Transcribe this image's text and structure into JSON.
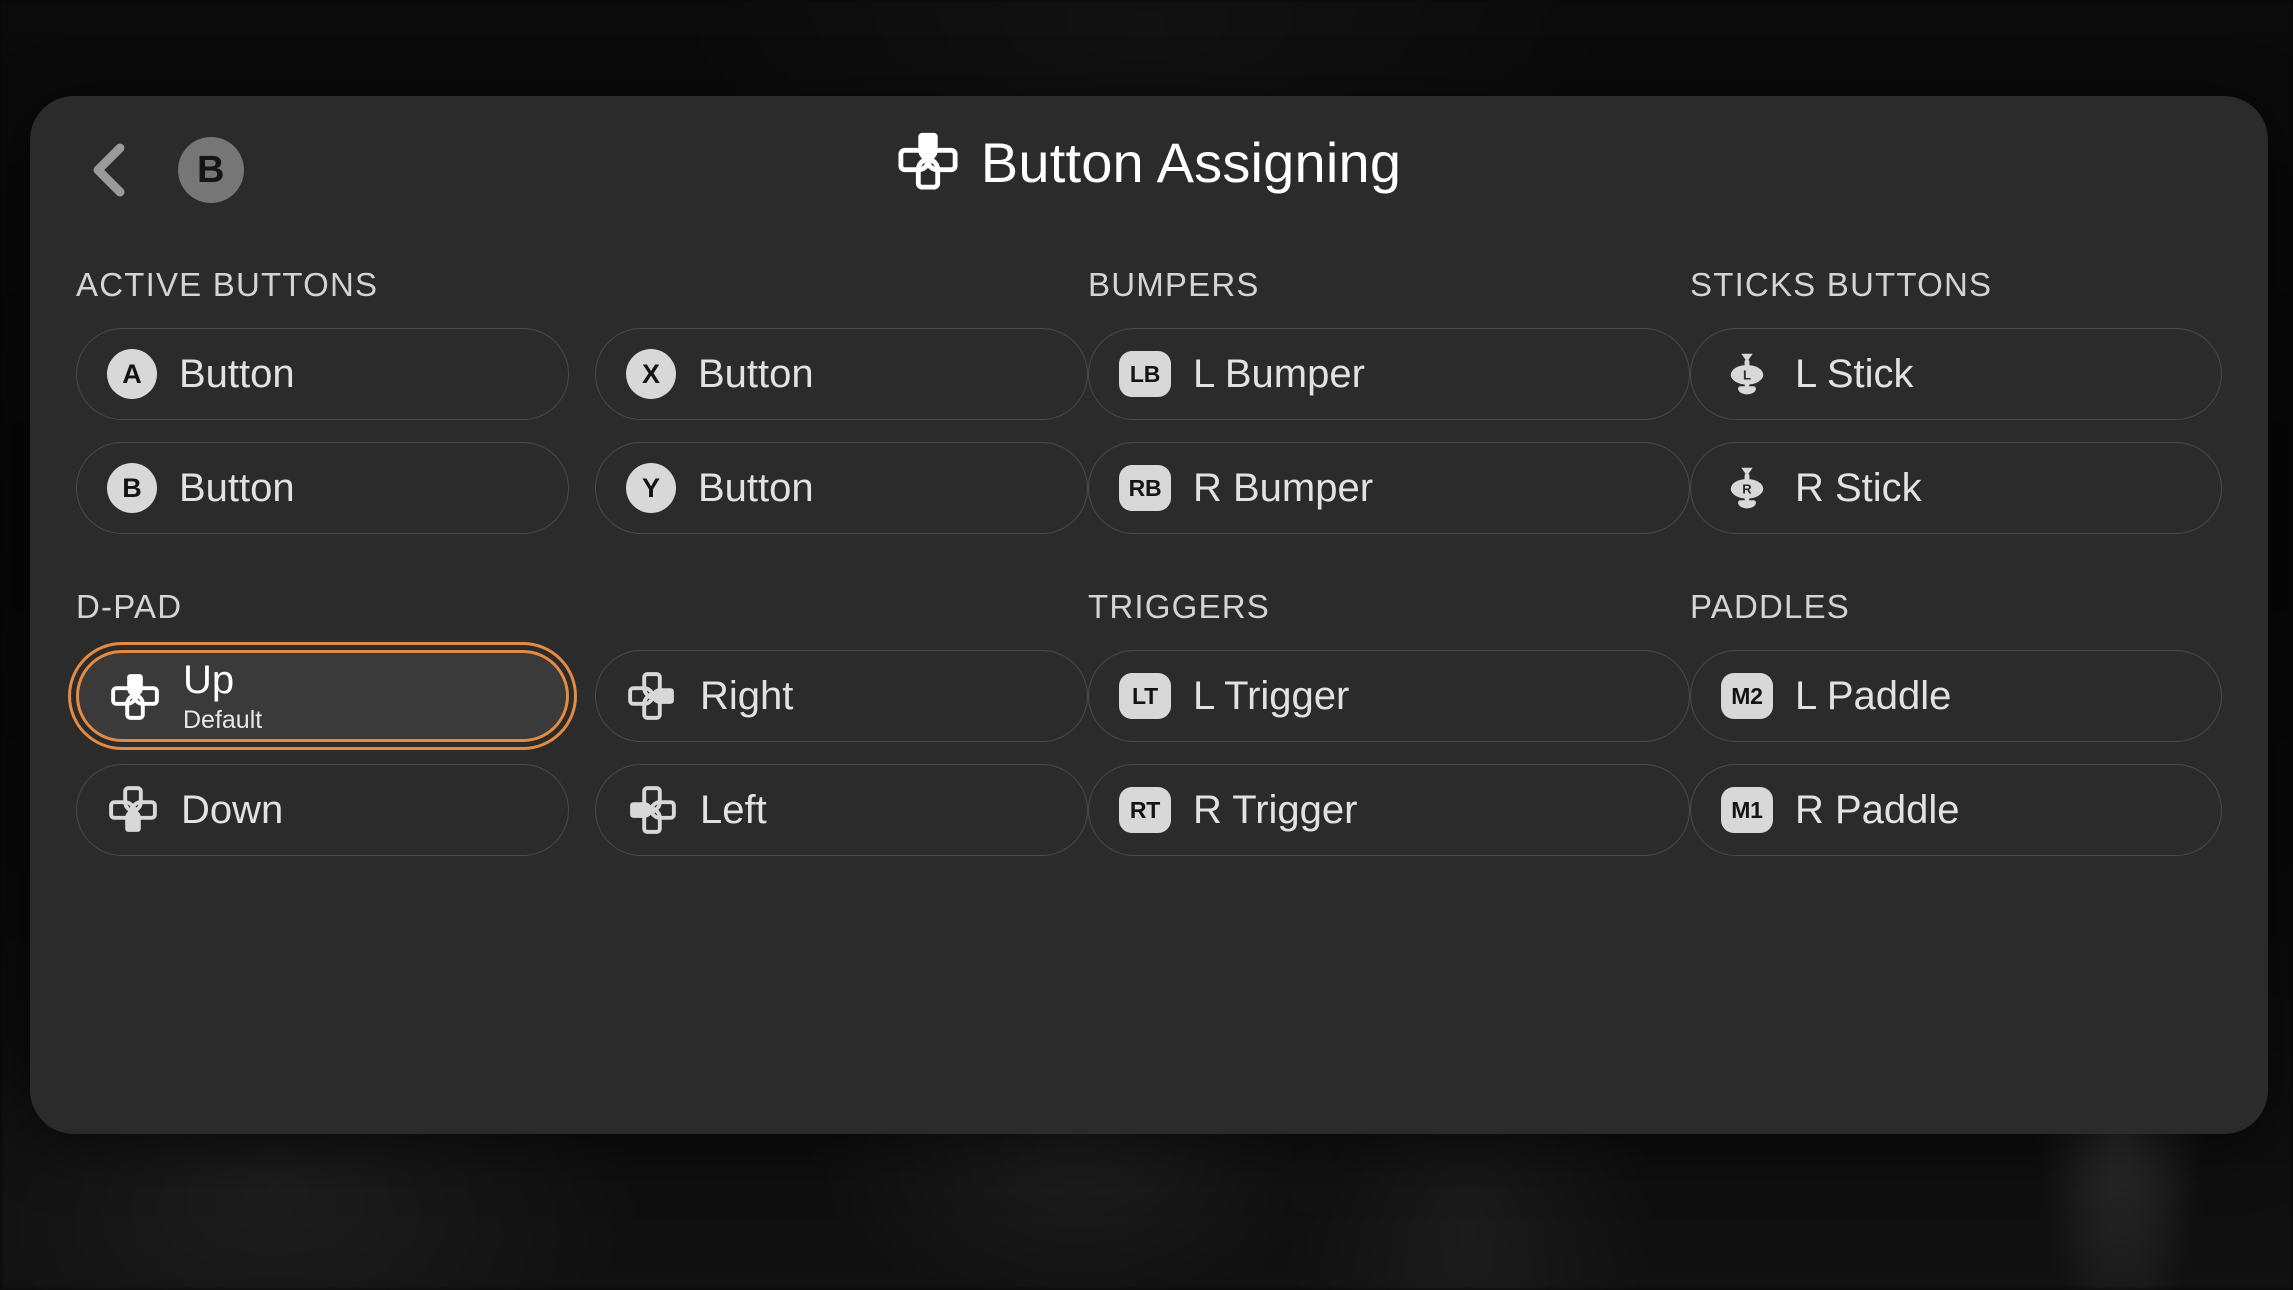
{
  "header": {
    "back_icon": "chevron-left-icon",
    "badge_label": "B",
    "title_icon": "dpad-icon",
    "title": "Button Assigning"
  },
  "colors": {
    "accent": "#e38b42",
    "panel_bg": "#2b2b2b",
    "page_bg": "#070707",
    "item_border": "#4a4a4a",
    "badge_bg": "#d8d8d8",
    "text_primary": "#e2e2e2",
    "section_label": "#d4d4d4"
  },
  "sections": [
    {
      "id": "active-buttons",
      "label": "ACTIVE BUTTONS",
      "columns": 2,
      "items": [
        {
          "badge_type": "circle",
          "badge": "A",
          "icon": "button-a-icon",
          "label": "Button",
          "selected": false
        },
        {
          "badge_type": "circle",
          "badge": "X",
          "icon": "button-x-icon",
          "label": "Button",
          "selected": false
        },
        {
          "badge_type": "circle",
          "badge": "B",
          "icon": "button-b-icon",
          "label": "Button",
          "selected": false
        },
        {
          "badge_type": "circle",
          "badge": "Y",
          "icon": "button-y-icon",
          "label": "Button",
          "selected": false
        }
      ]
    },
    {
      "id": "d-pad",
      "label": "D-PAD",
      "columns": 2,
      "items": [
        {
          "badge_type": "dpad",
          "dir": "up",
          "icon": "dpad-up-icon",
          "label": "Up",
          "sublabel": "Default",
          "selected": true
        },
        {
          "badge_type": "dpad",
          "dir": "right",
          "icon": "dpad-right-icon",
          "label": "Right",
          "selected": false
        },
        {
          "badge_type": "dpad",
          "dir": "down",
          "icon": "dpad-down-icon",
          "label": "Down",
          "selected": false
        },
        {
          "badge_type": "dpad",
          "dir": "left",
          "icon": "dpad-left-icon",
          "label": "Left",
          "selected": false
        }
      ]
    },
    {
      "id": "bumpers",
      "label": "BUMPERS",
      "columns": 1,
      "items": [
        {
          "badge_type": "rect",
          "badge": "LB",
          "icon": "bumper-lb-icon",
          "label": "L Bumper",
          "selected": false
        },
        {
          "badge_type": "rect",
          "badge": "RB",
          "icon": "bumper-rb-icon",
          "label": "R Bumper",
          "selected": false
        }
      ]
    },
    {
      "id": "triggers",
      "label": "TRIGGERS",
      "columns": 1,
      "items": [
        {
          "badge_type": "rect",
          "badge": "LT",
          "icon": "trigger-lt-icon",
          "label": "L Trigger",
          "selected": false
        },
        {
          "badge_type": "rect",
          "badge": "RT",
          "icon": "trigger-rt-icon",
          "label": "R Trigger",
          "selected": false
        }
      ]
    },
    {
      "id": "sticks-buttons",
      "label": "STICKS BUTTONS",
      "columns": 1,
      "items": [
        {
          "badge_type": "stick",
          "badge": "L",
          "icon": "stick-left-icon",
          "label": "L Stick",
          "selected": false
        },
        {
          "badge_type": "stick",
          "badge": "R",
          "icon": "stick-right-icon",
          "label": "R Stick",
          "selected": false
        }
      ]
    },
    {
      "id": "paddles",
      "label": "PADDLES",
      "columns": 1,
      "items": [
        {
          "badge_type": "rect",
          "badge": "M2",
          "icon": "paddle-m2-icon",
          "label": "L Paddle",
          "selected": false
        },
        {
          "badge_type": "rect",
          "badge": "M1",
          "icon": "paddle-m1-icon",
          "label": "R Paddle",
          "selected": false
        }
      ]
    }
  ],
  "layout": {
    "column_groups": [
      [
        "active-buttons",
        "d-pad"
      ],
      [
        "bumpers",
        "triggers"
      ],
      [
        "sticks-buttons",
        "paddles"
      ]
    ]
  }
}
